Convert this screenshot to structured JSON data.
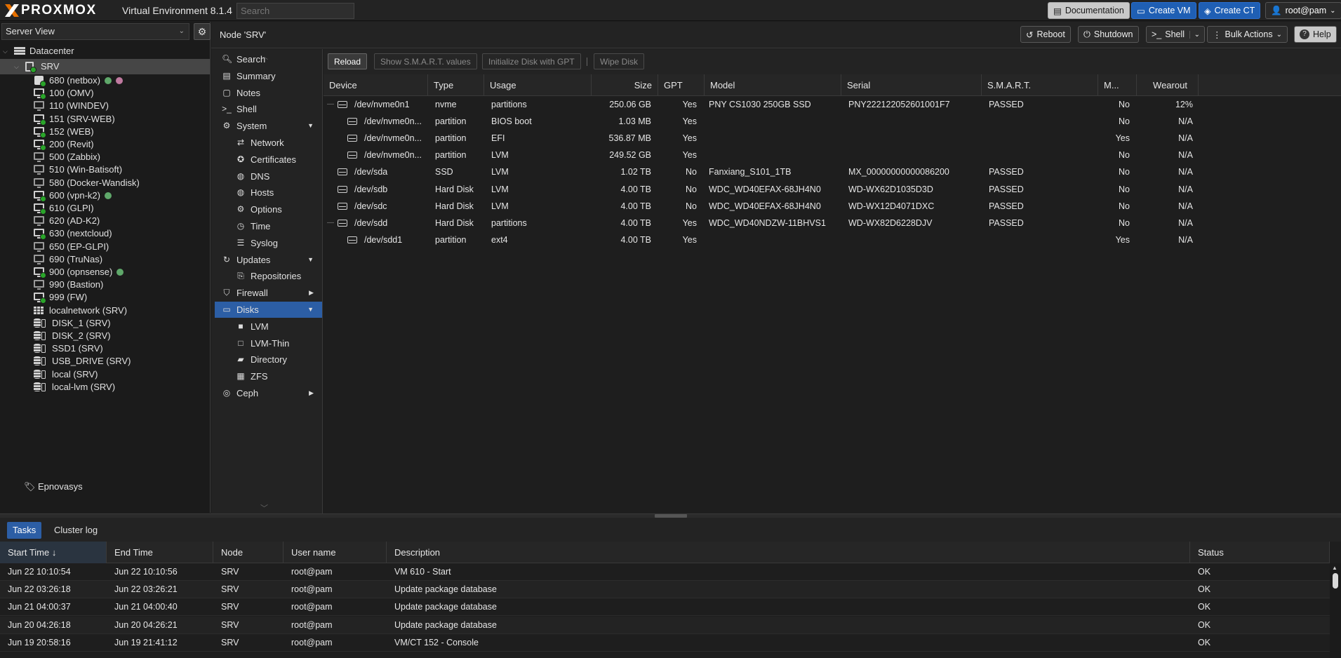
{
  "topbar": {
    "logo": "PROXMOX",
    "product": "Virtual Environment 8.1.4",
    "search_placeholder": "Search",
    "documentation": "Documentation",
    "create_vm": "Create VM",
    "create_ct": "Create CT",
    "user": "root@pam"
  },
  "tree": {
    "view": "Server View",
    "datacenter": "Datacenter",
    "node": "SRV",
    "items": [
      {
        "label": "680 (netbox)",
        "icon": "container-icon",
        "tags": [
          "#5fa86a",
          "#c07aa0"
        ]
      },
      {
        "label": "100 (OMV)",
        "icon": "vm-running-icon",
        "tags": []
      },
      {
        "label": "110 (WINDEV)",
        "icon": "vm-stopped-icon",
        "tags": []
      },
      {
        "label": "151 (SRV-WEB)",
        "icon": "vm-running-icon",
        "tags": []
      },
      {
        "label": "152 (WEB)",
        "icon": "vm-running-icon",
        "tags": []
      },
      {
        "label": "200 (Revit)",
        "icon": "vm-running-icon",
        "tags": []
      },
      {
        "label": "500 (Zabbix)",
        "icon": "vm-stopped-icon",
        "tags": []
      },
      {
        "label": "510 (Win-Batisoft)",
        "icon": "vm-stopped-icon",
        "tags": []
      },
      {
        "label": "580 (Docker-Wandisk)",
        "icon": "vm-stopped-icon",
        "tags": []
      },
      {
        "label": "600 (vpn-k2)",
        "icon": "vm-running-icon",
        "tags": [
          "#5fa86a"
        ]
      },
      {
        "label": "610 (GLPI)",
        "icon": "vm-running-icon",
        "tags": []
      },
      {
        "label": "620 (AD-K2)",
        "icon": "vm-stopped-icon",
        "tags": []
      },
      {
        "label": "630 (nextcloud)",
        "icon": "vm-running-icon",
        "tags": []
      },
      {
        "label": "650 (EP-GLPI)",
        "icon": "vm-stopped-icon",
        "tags": []
      },
      {
        "label": "690 (TruNas)",
        "icon": "vm-stopped-icon",
        "tags": []
      },
      {
        "label": "900 (opnsense)",
        "icon": "vm-running-icon",
        "tags": [
          "#5fa86a"
        ]
      },
      {
        "label": "990 (Bastion)",
        "icon": "vm-stopped-icon",
        "tags": []
      },
      {
        "label": "999 (FW)",
        "icon": "vm-running-icon",
        "tags": []
      },
      {
        "label": "localnetwork (SRV)",
        "icon": "network-grid-icon",
        "tags": []
      },
      {
        "label": "DISK_1 (SRV)",
        "icon": "storage-icon",
        "tags": []
      },
      {
        "label": "DISK_2 (SRV)",
        "icon": "storage-icon",
        "tags": []
      },
      {
        "label": "SSD1 (SRV)",
        "icon": "storage-icon",
        "tags": []
      },
      {
        "label": "USB_DRIVE (SRV)",
        "icon": "storage-icon",
        "tags": []
      },
      {
        "label": "local (SRV)",
        "icon": "storage-icon",
        "tags": []
      },
      {
        "label": "local-lvm (SRV)",
        "icon": "storage-icon",
        "tags": []
      }
    ],
    "pool": "Epnovasys"
  },
  "header": {
    "title": "Node 'SRV'",
    "reboot": "Reboot",
    "shutdown": "Shutdown",
    "shell": "Shell",
    "bulk": "Bulk Actions",
    "help": "Help"
  },
  "nav": [
    {
      "label": "Search",
      "icon": "search-icon",
      "sub": false
    },
    {
      "label": "Summary",
      "icon": "book-icon",
      "sub": false
    },
    {
      "label": "Notes",
      "icon": "notes-icon",
      "sub": false
    },
    {
      "label": "Shell",
      "icon": "terminal-icon",
      "sub": false
    },
    {
      "label": "System",
      "icon": "gears-icon",
      "sub": false,
      "arrow": "down"
    },
    {
      "label": "Network",
      "icon": "network-icon",
      "sub": true
    },
    {
      "label": "Certificates",
      "icon": "certificate-icon",
      "sub": true
    },
    {
      "label": "DNS",
      "icon": "globe-icon",
      "sub": true
    },
    {
      "label": "Hosts",
      "icon": "globe-icon",
      "sub": true
    },
    {
      "label": "Options",
      "icon": "gear-icon",
      "sub": true
    },
    {
      "label": "Time",
      "icon": "clock-icon",
      "sub": true
    },
    {
      "label": "Syslog",
      "icon": "list-icon",
      "sub": true
    },
    {
      "label": "Updates",
      "icon": "refresh-icon",
      "sub": false,
      "arrow": "down"
    },
    {
      "label": "Repositories",
      "icon": "repository-icon",
      "sub": true
    },
    {
      "label": "Firewall",
      "icon": "shield-icon",
      "sub": false,
      "arrow": "right"
    },
    {
      "label": "Disks",
      "icon": "hdd-icon",
      "sub": false,
      "arrow": "down",
      "active": true
    },
    {
      "label": "LVM",
      "icon": "square-icon",
      "sub": true
    },
    {
      "label": "LVM-Thin",
      "icon": "square-outline-icon",
      "sub": true
    },
    {
      "label": "Directory",
      "icon": "folder-icon",
      "sub": true
    },
    {
      "label": "ZFS",
      "icon": "table-icon",
      "sub": true
    },
    {
      "label": "Ceph",
      "icon": "ceph-icon",
      "sub": false,
      "arrow": "right"
    }
  ],
  "disks": {
    "toolbar": {
      "reload": "Reload",
      "smart": "Show S.M.A.R.T. values",
      "init_gpt": "Initialize Disk with GPT",
      "wipe": "Wipe Disk"
    },
    "columns": [
      "Device",
      "Type",
      "Usage",
      "Size",
      "GPT",
      "Model",
      "Serial",
      "S.M.A.R.T.",
      "M...",
      "Wearout"
    ],
    "rows": [
      {
        "device": "/dev/nvme0n1",
        "child": false,
        "expander": true,
        "type": "nvme",
        "usage": "partitions",
        "size": "250.06 GB",
        "gpt": "Yes",
        "model": "PNY CS1030 250GB SSD",
        "serial": "PNY222122052601001F7",
        "smart": "PASSED",
        "mounted": "No",
        "wearout": "12%"
      },
      {
        "device": "/dev/nvme0n...",
        "child": true,
        "type": "partition",
        "usage": "BIOS boot",
        "size": "1.03 MB",
        "gpt": "Yes",
        "model": "",
        "serial": "",
        "smart": "",
        "mounted": "No",
        "wearout": "N/A"
      },
      {
        "device": "/dev/nvme0n...",
        "child": true,
        "type": "partition",
        "usage": "EFI",
        "size": "536.87 MB",
        "gpt": "Yes",
        "model": "",
        "serial": "",
        "smart": "",
        "mounted": "Yes",
        "wearout": "N/A"
      },
      {
        "device": "/dev/nvme0n...",
        "child": true,
        "type": "partition",
        "usage": "LVM",
        "size": "249.52 GB",
        "gpt": "Yes",
        "model": "",
        "serial": "",
        "smart": "",
        "mounted": "No",
        "wearout": "N/A"
      },
      {
        "device": "/dev/sda",
        "child": false,
        "type": "SSD",
        "usage": "LVM",
        "size": "1.02 TB",
        "gpt": "No",
        "model": "Fanxiang_S101_1TB",
        "serial": "MX_00000000000086200",
        "smart": "PASSED",
        "mounted": "No",
        "wearout": "N/A"
      },
      {
        "device": "/dev/sdb",
        "child": false,
        "type": "Hard Disk",
        "usage": "LVM",
        "size": "4.00 TB",
        "gpt": "No",
        "model": "WDC_WD40EFAX-68JH4N0",
        "serial": "WD-WX62D1035D3D",
        "smart": "PASSED",
        "mounted": "No",
        "wearout": "N/A"
      },
      {
        "device": "/dev/sdc",
        "child": false,
        "type": "Hard Disk",
        "usage": "LVM",
        "size": "4.00 TB",
        "gpt": "No",
        "model": "WDC_WD40EFAX-68JH4N0",
        "serial": "WD-WX12D4071DXC",
        "smart": "PASSED",
        "mounted": "No",
        "wearout": "N/A"
      },
      {
        "device": "/dev/sdd",
        "child": false,
        "expander": true,
        "type": "Hard Disk",
        "usage": "partitions",
        "size": "4.00 TB",
        "gpt": "Yes",
        "model": "WDC_WD40NDZW-11BHVS1",
        "serial": "WD-WX82D6228DJV",
        "smart": "PASSED",
        "mounted": "No",
        "wearout": "N/A"
      },
      {
        "device": "/dev/sdd1",
        "child": true,
        "type": "partition",
        "usage": "ext4",
        "size": "4.00 TB",
        "gpt": "Yes",
        "model": "",
        "serial": "",
        "smart": "",
        "mounted": "Yes",
        "wearout": "N/A"
      }
    ]
  },
  "tasks": {
    "tabs": [
      "Tasks",
      "Cluster log"
    ],
    "columns": [
      "Start Time ↓",
      "End Time",
      "Node",
      "User name",
      "Description",
      "Status"
    ],
    "rows": [
      {
        "start": "Jun 22 10:10:54",
        "end": "Jun 22 10:10:56",
        "node": "SRV",
        "user": "root@pam",
        "desc": "VM 610 - Start",
        "status": "OK"
      },
      {
        "start": "Jun 22 03:26:18",
        "end": "Jun 22 03:26:21",
        "node": "SRV",
        "user": "root@pam",
        "desc": "Update package database",
        "status": "OK"
      },
      {
        "start": "Jun 21 04:00:37",
        "end": "Jun 21 04:00:40",
        "node": "SRV",
        "user": "root@pam",
        "desc": "Update package database",
        "status": "OK"
      },
      {
        "start": "Jun 20 04:26:18",
        "end": "Jun 20 04:26:21",
        "node": "SRV",
        "user": "root@pam",
        "desc": "Update package database",
        "status": "OK"
      },
      {
        "start": "Jun 19 20:58:16",
        "end": "Jun 19 21:41:12",
        "node": "SRV",
        "user": "root@pam",
        "desc": "VM/CT 152 - Console",
        "status": "OK"
      }
    ]
  },
  "colors": {
    "accent": "#2c5ea5",
    "running": "#2aa52a",
    "brand_orange": "#e57000"
  }
}
